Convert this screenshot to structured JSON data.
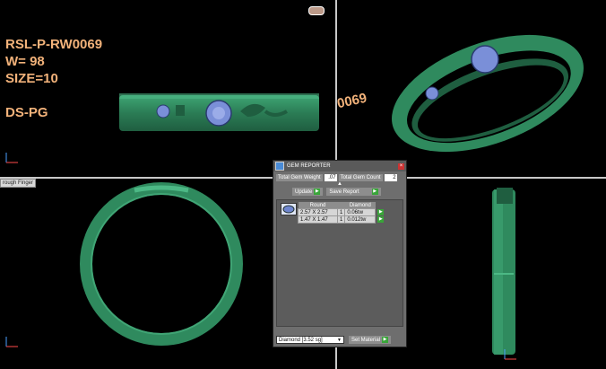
{
  "viewport_top_left": {
    "info_lines": [
      "RSL-P-RW0069",
      "W= 98",
      "SIZE=10",
      "",
      "DS-PG"
    ],
    "axis_label": "x"
  },
  "viewport_top_right": {
    "watermark": "0069"
  },
  "viewport_bottom_left": {
    "tag": "rough Finger"
  },
  "gem_reporter": {
    "title": "GEM REPORTER",
    "total_gem_weight_label": "Total Gem Weight",
    "total_gem_weight_value": ".07",
    "total_gem_count_label": "Total Gem Count",
    "total_gem_count_value": "2",
    "update_label": "Update",
    "save_report_label": "Save Report",
    "table": {
      "headers": [
        "Round",
        "",
        "Diamond"
      ],
      "rows": [
        [
          "2.57 X 2.57",
          "1",
          "0.06tw"
        ],
        [
          "1.47 X 1.47",
          "1",
          "0.012tw"
        ]
      ]
    },
    "material_select": "Diamond    [3.52 sg]",
    "set_material_label": "Set Material"
  },
  "colors": {
    "ring_green": "#2f8a5e",
    "gem_blue": "#7a8fd8",
    "text_orange": "#f2b27a"
  }
}
